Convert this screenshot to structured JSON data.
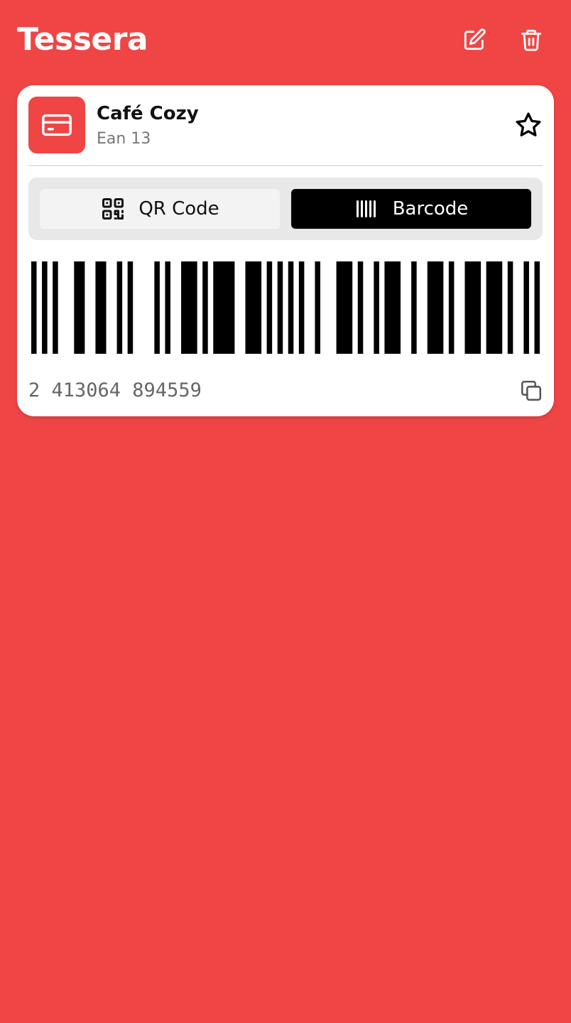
{
  "app": {
    "title": "Tessera"
  },
  "header": {
    "edit_icon": "edit-icon",
    "delete_icon": "trash-icon"
  },
  "card": {
    "name": "Café Cozy",
    "type": "Ean 13",
    "accent_color": "#F04545",
    "icon": "credit-card-icon",
    "favorite_icon": "star-icon",
    "favorited": false
  },
  "code_toggle": {
    "options": [
      {
        "label": "QR Code",
        "icon": "qr-code-icon",
        "selected": false
      },
      {
        "label": "Barcode",
        "icon": "barcode-icon",
        "selected": true
      }
    ]
  },
  "barcode": {
    "format": "EAN-13",
    "value": "2413064894559",
    "display": "2 413064 894559",
    "copy_icon": "copy-icon"
  },
  "colors": {
    "background": "#F04545",
    "card": "#FFFFFF",
    "selected_segment": "#000000"
  }
}
